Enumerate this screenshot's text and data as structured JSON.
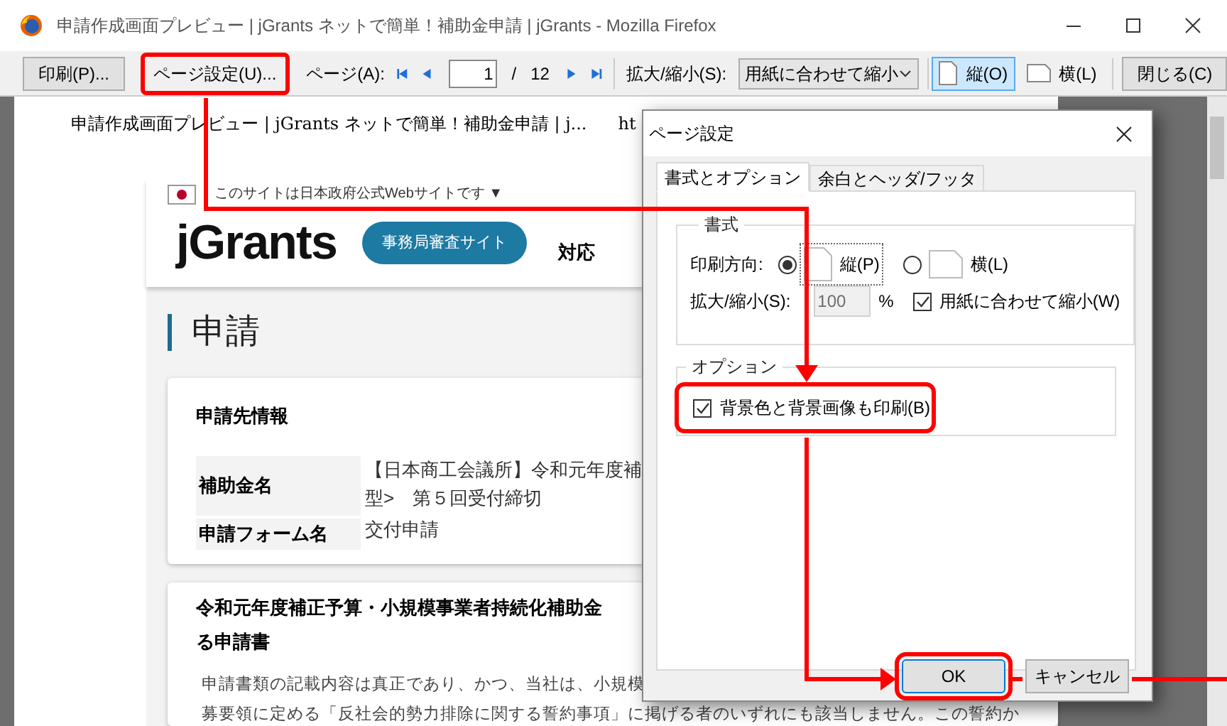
{
  "window": {
    "title": "申請作成画面プレビュー | jGrants ネットで簡単！補助金申請 | jGrants - Mozilla Firefox"
  },
  "toolbar": {
    "print_button": "印刷(P)...",
    "page_setup_button": {
      "label": "ページ設定(U)...",
      "highlighted": true
    },
    "page_label": "ページ(A):",
    "page_input": "1",
    "page_total": "/",
    "page_count": "12",
    "scale_label": "拡大/縮小(S):",
    "scale_select": "用紙に合わせて縮小",
    "orientation": [
      {
        "label": "縦(O)",
        "selected": true
      },
      {
        "label": "横(L)",
        "selected": false
      }
    ],
    "close_button": "閉じる(C)"
  },
  "preview": {
    "page_header": "申請作成画面プレビュー | jGrants ネットで簡単！補助金申請 | j...",
    "page_url": "ht",
    "site_notice": "このサイトは日本政府公式Webサイトです ▼",
    "logo": "jGrants",
    "review_site_button": "事務局審査サイト",
    "nav_item": "対応",
    "heading": "申請",
    "info_card": {
      "title": "申請先情報",
      "rows": [
        {
          "label": "補助金名",
          "value_lines": [
            "【日本商工会議所】令和元年度補",
            "型>　第５回受付締切"
          ]
        },
        {
          "label": "申請フォーム名",
          "value_lines": [
            "交付申請"
          ]
        }
      ]
    },
    "form_card": {
      "title_lines": [
        "令和元年度補正予算・小規模事業者持続化補助金",
        "る申請書"
      ],
      "body_lines": [
        "申請書類の記載内容は真正であり、かつ、当社は、小規模",
        "募要領に定める「反社会的勢力排除に関する誓約事項」に掲げる者のいずれにも該当しません。この誓約か"
      ]
    }
  },
  "dialog": {
    "title": "ページ設定",
    "tabs": [
      {
        "label": "書式とオプション",
        "selected": true
      },
      {
        "label": "余白とヘッダ/フッタ",
        "selected": false
      }
    ],
    "format_group": {
      "legend": "書式",
      "orientation_label": "印刷方向:",
      "orientation_options": [
        {
          "label": "縦(P)",
          "selected": true
        },
        {
          "label": "横(L)",
          "selected": false
        }
      ],
      "scale_label": "拡大/縮小(S):",
      "scale_value": "100",
      "scale_disabled": true,
      "percent": "%",
      "shrink_to_fit": {
        "label": "用紙に合わせて縮小(W)",
        "checked": true
      }
    },
    "options_group": {
      "legend": "オプション",
      "print_background": {
        "label": "背景色と背景画像も印刷(B)",
        "checked": true,
        "highlighted": true
      }
    },
    "buttons": [
      {
        "label": "OK",
        "highlighted": true
      },
      {
        "label": "キャンセル",
        "highlighted": false
      }
    ]
  }
}
